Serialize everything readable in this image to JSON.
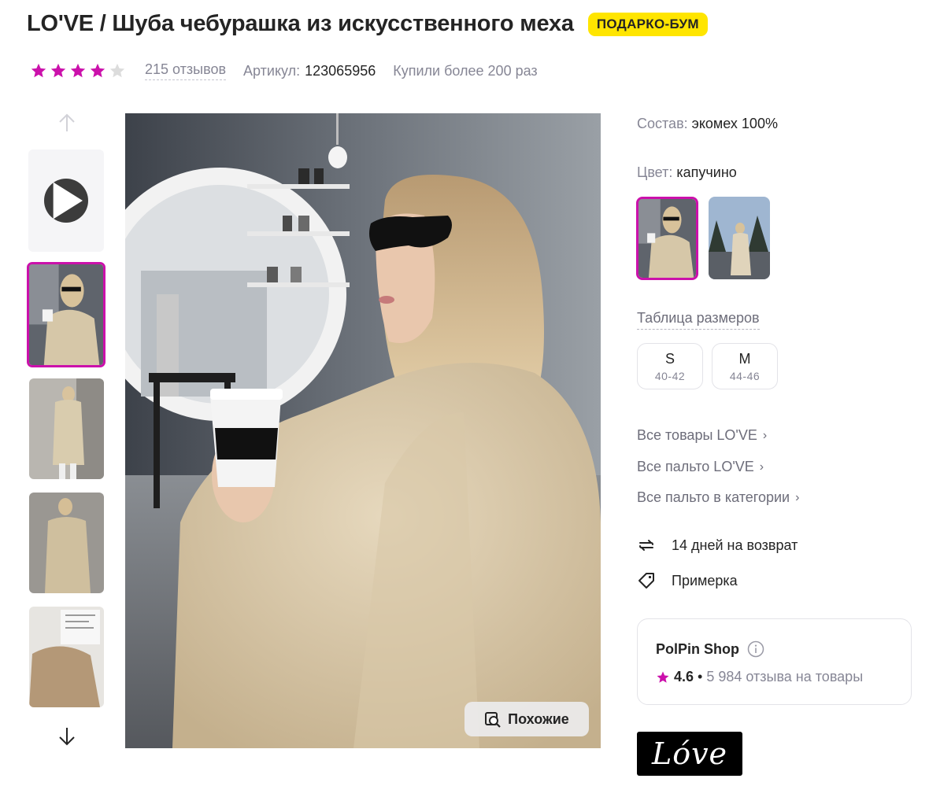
{
  "product": {
    "title": "LO'VE / Шуба чебурашка из искусственного меха",
    "promo_badge": "ПОДАРКО-БУМ",
    "rating_stars": 4,
    "reviews_text": "215 отзывов",
    "article_label": "Артикул:",
    "article_value": "123065956",
    "bought_text": "Купили более 200 раз"
  },
  "gallery": {
    "similar_label": "Похожие",
    "thumbnails": [
      "video",
      "photo-1",
      "photo-2",
      "photo-3",
      "photo-4"
    ],
    "selected_index": 1
  },
  "specs": {
    "composition_label": "Состав:",
    "composition_value": "экомех 100%",
    "color_label": "Цвет:",
    "color_value": "капучино"
  },
  "sizes": {
    "table_link": "Таблица размеров",
    "options": [
      {
        "size": "S",
        "range": "40-42"
      },
      {
        "size": "M",
        "range": "44-46"
      }
    ]
  },
  "links": [
    {
      "label": "Все товары LO'VE",
      "chevron": "›"
    },
    {
      "label": "Все пальто LO'VE",
      "chevron": "›"
    },
    {
      "label": "Все пальто в категории",
      "chevron": "›"
    }
  ],
  "features": [
    {
      "icon": "return-arrows-icon",
      "label": "14 дней на возврат"
    },
    {
      "icon": "tag-icon",
      "label": "Примерка"
    }
  ],
  "shop": {
    "name": "PolPin Shop",
    "rating": "4.6",
    "separator": "•",
    "reviews": "5 984 отзыва на товары"
  },
  "brand": {
    "logo_text": "Lóve"
  },
  "colors": {
    "accent": "#cb11ab",
    "badge": "#ffe500",
    "muted_text": "#868695",
    "star_empty": "#dcdcdc"
  }
}
